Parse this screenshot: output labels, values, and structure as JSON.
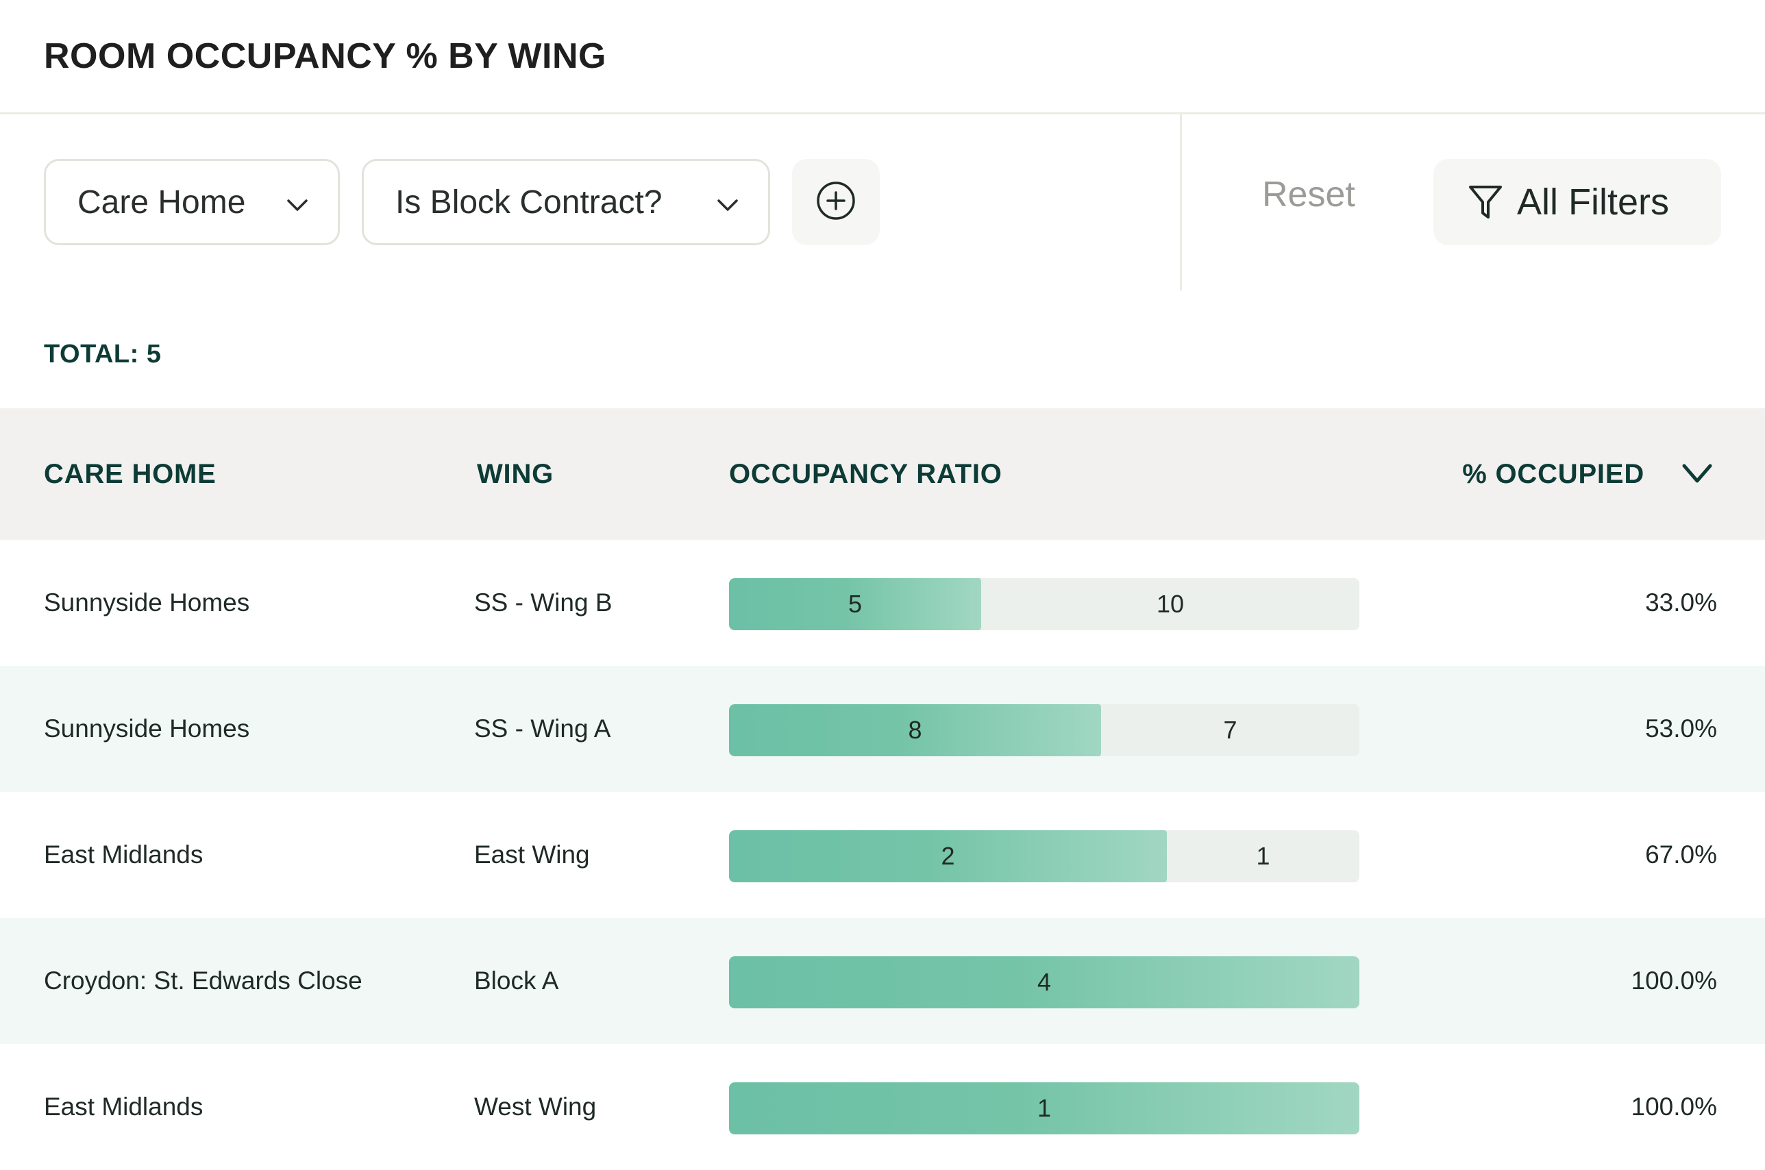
{
  "header": {
    "title": "ROOM OCCUPANCY % BY WING"
  },
  "filters": {
    "care_home": "Care Home",
    "block_contract": "Is Block Contract?",
    "reset": "Reset",
    "all_filters": "All Filters"
  },
  "summary": {
    "total": "TOTAL: 5"
  },
  "table": {
    "columns": {
      "care_home": "CARE HOME",
      "wing": "WING",
      "occupancy_ratio": "OCCUPANCY RATIO",
      "pct_occupied": "% OCCUPIED"
    },
    "sort": {
      "column": "pct_occupied",
      "icon": "chevron-down-icon"
    },
    "rows": [
      {
        "care_home": "Sunnyside Homes",
        "wing": "SS - Wing B",
        "occupied": 5,
        "vacant": 10,
        "occupied_label": "5",
        "vacant_label": "10",
        "fill_fraction": 0.4,
        "pct": "33.0%"
      },
      {
        "care_home": "Sunnyside Homes",
        "wing": "SS - Wing A",
        "occupied": 8,
        "vacant": 7,
        "occupied_label": "8",
        "vacant_label": "7",
        "fill_fraction": 0.59,
        "pct": "53.0%"
      },
      {
        "care_home": "East Midlands",
        "wing": "East Wing",
        "occupied": 2,
        "vacant": 1,
        "occupied_label": "2",
        "vacant_label": "1",
        "fill_fraction": 0.695,
        "pct": "67.0%"
      },
      {
        "care_home": "Croydon: St. Edwards Close",
        "wing": "Block A",
        "occupied": 4,
        "vacant": 0,
        "occupied_label": "4",
        "vacant_label": "",
        "fill_fraction": 1.0,
        "pct": "100.0%"
      },
      {
        "care_home": "East Midlands",
        "wing": "West Wing",
        "occupied": 1,
        "vacant": 0,
        "occupied_label": "1",
        "vacant_label": "",
        "fill_fraction": 1.0,
        "pct": "100.0%"
      }
    ]
  },
  "colors": {
    "accent_dark": "#0d3b36",
    "bar_fill": "#6cc0a5",
    "bar_track": "#ebf0ec",
    "row_alt": "#f1f8f6",
    "header_bg": "#f2f1ef"
  }
}
